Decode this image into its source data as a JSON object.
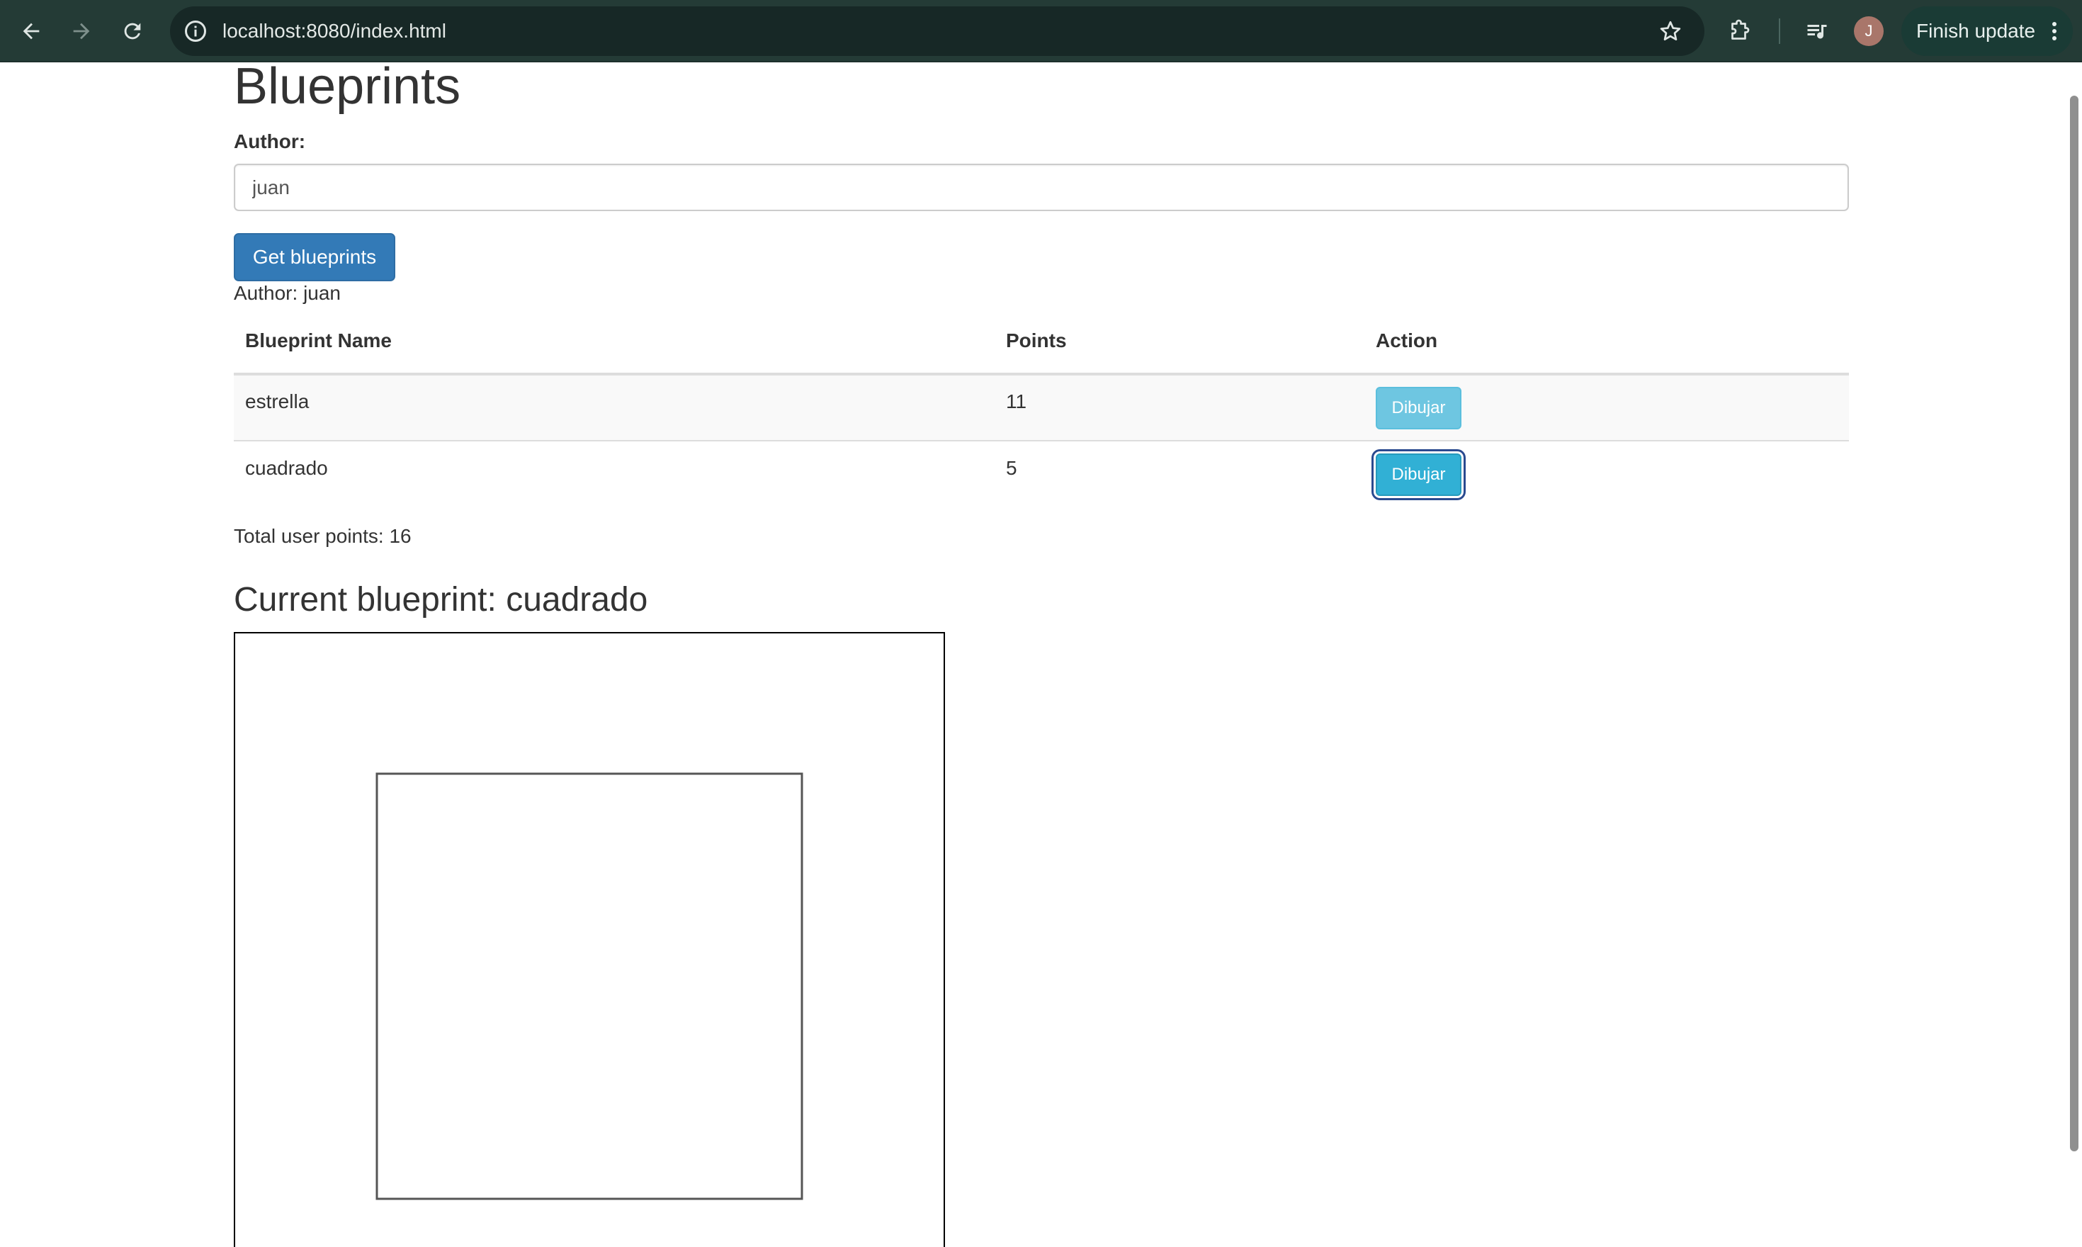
{
  "browser": {
    "url": "localhost:8080/index.html",
    "profile_initial": "J",
    "finish_update_label": "Finish update",
    "icons": [
      "back-arrow-icon",
      "forward-arrow-icon",
      "reload-icon",
      "site-info-icon",
      "bookmark-star-icon",
      "extensions-puzzle-icon",
      "media-controls-icon",
      "more-vert-icon"
    ]
  },
  "page": {
    "title": "Blueprints",
    "author_label": "Author:",
    "author_value": "juan",
    "get_button_label": "Get blueprints",
    "author_line_prefix": "Author: ",
    "author_line_value": "juan",
    "table": {
      "headers": [
        "Blueprint Name",
        "Points",
        "Action"
      ],
      "rows": [
        {
          "name": "estrella",
          "points": "11",
          "action": "Dibujar"
        },
        {
          "name": "cuadrado",
          "points": "5",
          "action": "Dibujar"
        }
      ]
    },
    "total_points_text": "Total user points: 16",
    "current_prefix": "Current blueprint: ",
    "current_name": "cuadrado"
  },
  "colors": {
    "chrome_bg": "#243b36",
    "primary_button": "#337ab7",
    "info_button": "#5bc0de"
  }
}
